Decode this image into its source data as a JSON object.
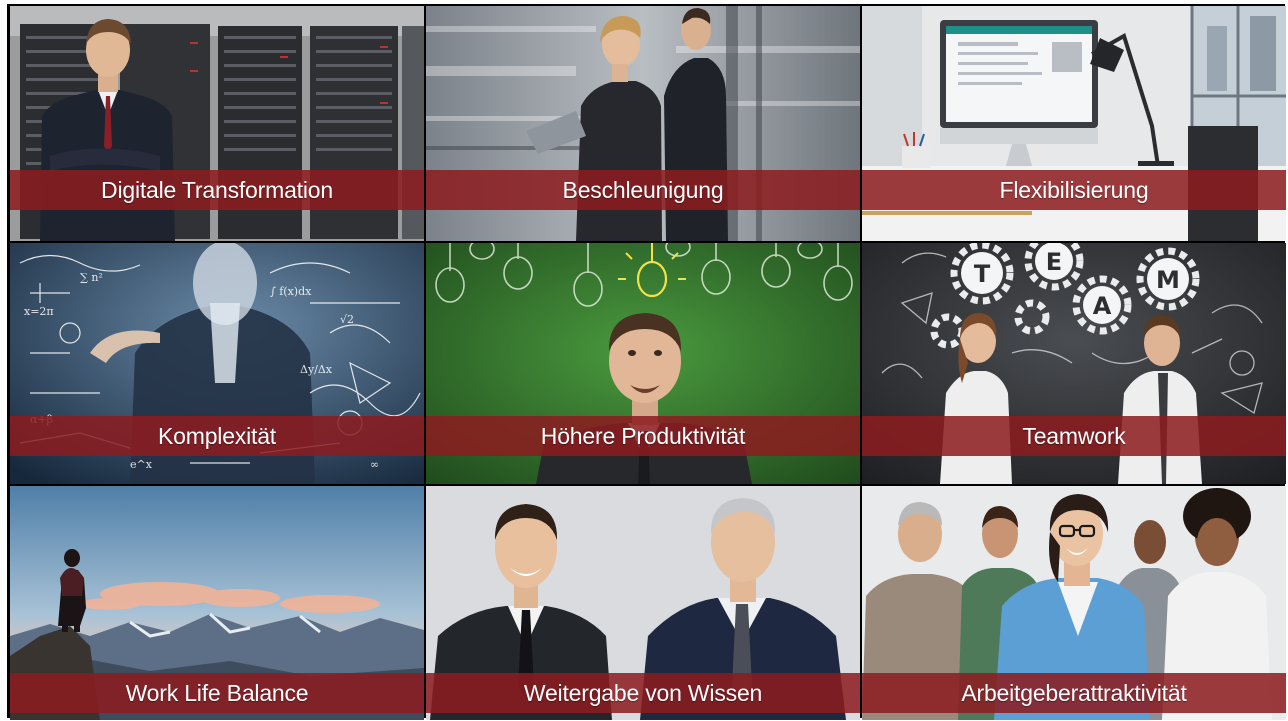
{
  "tiles": [
    {
      "id": "digitale-transformation",
      "label": "Digitale Transformation",
      "image": "businessman-server-room-photo"
    },
    {
      "id": "beschleunigung",
      "label": "Beschleunigung",
      "image": "business-people-walking-motion-blur-photo"
    },
    {
      "id": "flexibilisierung",
      "label": "Flexibilisierung",
      "image": "office-desk-computer-lamp-photo"
    },
    {
      "id": "komplexitaet",
      "label": "Komplexität",
      "image": "man-writing-math-formulas-on-glass-photo"
    },
    {
      "id": "hoehere-produktivitaet",
      "label": "Höhere Produktivität",
      "image": "man-under-lightbulbs-green-chalkboard-photo"
    },
    {
      "id": "teamwork",
      "label": "Teamwork",
      "image": "team-gears-chalkboard-photo"
    },
    {
      "id": "work-life-balance",
      "label": "Work Life Balance",
      "image": "hiker-on-mountain-summit-photo"
    },
    {
      "id": "weitergabe-von-wissen",
      "label": "Weitergabe von Wissen",
      "image": "young-and-senior-businessmen-photo"
    },
    {
      "id": "arbeitgeberattraktivitaet",
      "label": "Arbeitgeberattraktivität",
      "image": "smiling-diverse-team-photo"
    }
  ],
  "colors": {
    "banner": "#8c1c20",
    "banner_text": "#ffffff",
    "frame": "#000000"
  }
}
